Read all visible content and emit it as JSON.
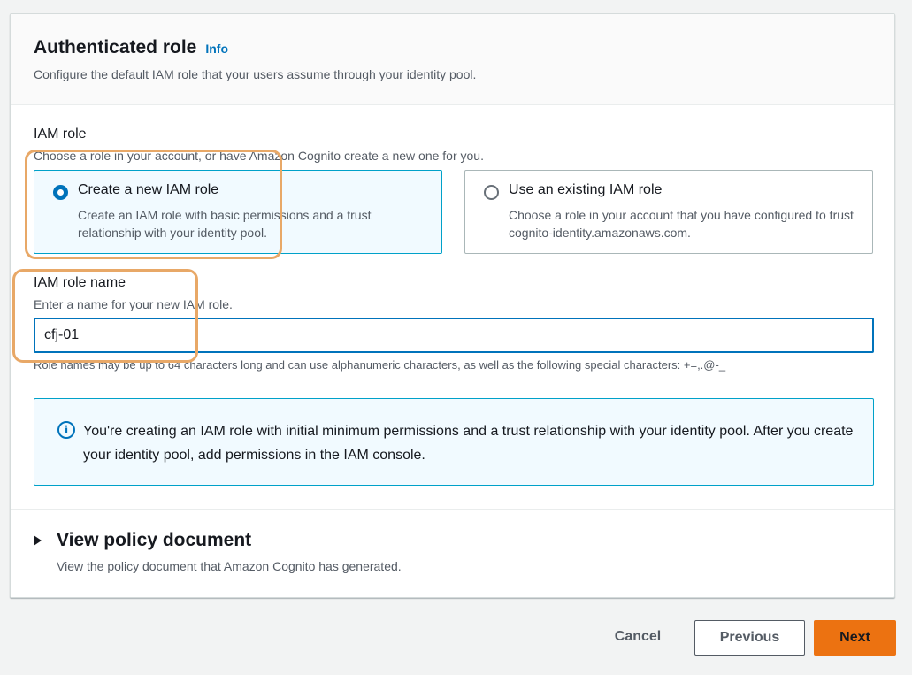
{
  "section": {
    "title": "Authenticated role",
    "info_link": "Info",
    "description": "Configure the default IAM role that your users assume through your identity pool."
  },
  "iam_role": {
    "label": "IAM role",
    "description": "Choose a role in your account, or have Amazon Cognito create a new one for you.",
    "options": [
      {
        "title": "Create a new IAM role",
        "description": "Create an IAM role with basic permissions and a trust relationship with your identity pool.",
        "selected": true
      },
      {
        "title": "Use an existing IAM role",
        "description": "Choose a role in your account that you have configured to trust cognito-identity.amazonaws.com.",
        "selected": false
      }
    ]
  },
  "iam_role_name": {
    "label": "IAM role name",
    "description": "Enter a name for your new IAM role.",
    "value": "cfj-01",
    "constraint": "Role names may be up to 64 characters long and can use alphanumeric characters, as well as the following special characters: +=,.@-_"
  },
  "alert": {
    "icon": "info-icon",
    "text": "You're creating an IAM role with initial minimum permissions and a trust relationship with your identity pool. After you create your identity pool, add permissions in the IAM console."
  },
  "policy_document": {
    "title": "View policy document",
    "description": "View the policy document that Amazon Cognito has generated."
  },
  "footer": {
    "cancel_label": "Cancel",
    "previous_label": "Previous",
    "next_label": "Next"
  },
  "colors": {
    "accent": "#0073bb",
    "primary_button": "#ec7211",
    "highlight": "#e8a867"
  }
}
